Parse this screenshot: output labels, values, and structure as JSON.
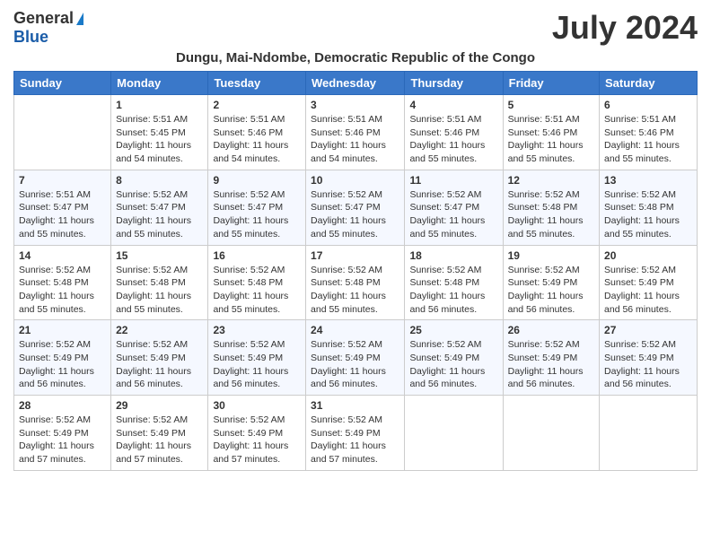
{
  "logo": {
    "general": "General",
    "blue": "Blue"
  },
  "title": "July 2024",
  "subtitle": "Dungu, Mai-Ndombe, Democratic Republic of the Congo",
  "days_of_week": [
    "Sunday",
    "Monday",
    "Tuesday",
    "Wednesday",
    "Thursday",
    "Friday",
    "Saturday"
  ],
  "weeks": [
    [
      {
        "day": "",
        "sunrise": "",
        "sunset": "",
        "daylight": ""
      },
      {
        "day": "1",
        "sunrise": "Sunrise: 5:51 AM",
        "sunset": "Sunset: 5:45 PM",
        "daylight": "Daylight: 11 hours and 54 minutes."
      },
      {
        "day": "2",
        "sunrise": "Sunrise: 5:51 AM",
        "sunset": "Sunset: 5:46 PM",
        "daylight": "Daylight: 11 hours and 54 minutes."
      },
      {
        "day": "3",
        "sunrise": "Sunrise: 5:51 AM",
        "sunset": "Sunset: 5:46 PM",
        "daylight": "Daylight: 11 hours and 54 minutes."
      },
      {
        "day": "4",
        "sunrise": "Sunrise: 5:51 AM",
        "sunset": "Sunset: 5:46 PM",
        "daylight": "Daylight: 11 hours and 55 minutes."
      },
      {
        "day": "5",
        "sunrise": "Sunrise: 5:51 AM",
        "sunset": "Sunset: 5:46 PM",
        "daylight": "Daylight: 11 hours and 55 minutes."
      },
      {
        "day": "6",
        "sunrise": "Sunrise: 5:51 AM",
        "sunset": "Sunset: 5:46 PM",
        "daylight": "Daylight: 11 hours and 55 minutes."
      }
    ],
    [
      {
        "day": "7",
        "sunrise": "Sunrise: 5:51 AM",
        "sunset": "Sunset: 5:47 PM",
        "daylight": "Daylight: 11 hours and 55 minutes."
      },
      {
        "day": "8",
        "sunrise": "Sunrise: 5:52 AM",
        "sunset": "Sunset: 5:47 PM",
        "daylight": "Daylight: 11 hours and 55 minutes."
      },
      {
        "day": "9",
        "sunrise": "Sunrise: 5:52 AM",
        "sunset": "Sunset: 5:47 PM",
        "daylight": "Daylight: 11 hours and 55 minutes."
      },
      {
        "day": "10",
        "sunrise": "Sunrise: 5:52 AM",
        "sunset": "Sunset: 5:47 PM",
        "daylight": "Daylight: 11 hours and 55 minutes."
      },
      {
        "day": "11",
        "sunrise": "Sunrise: 5:52 AM",
        "sunset": "Sunset: 5:47 PM",
        "daylight": "Daylight: 11 hours and 55 minutes."
      },
      {
        "day": "12",
        "sunrise": "Sunrise: 5:52 AM",
        "sunset": "Sunset: 5:48 PM",
        "daylight": "Daylight: 11 hours and 55 minutes."
      },
      {
        "day": "13",
        "sunrise": "Sunrise: 5:52 AM",
        "sunset": "Sunset: 5:48 PM",
        "daylight": "Daylight: 11 hours and 55 minutes."
      }
    ],
    [
      {
        "day": "14",
        "sunrise": "Sunrise: 5:52 AM",
        "sunset": "Sunset: 5:48 PM",
        "daylight": "Daylight: 11 hours and 55 minutes."
      },
      {
        "day": "15",
        "sunrise": "Sunrise: 5:52 AM",
        "sunset": "Sunset: 5:48 PM",
        "daylight": "Daylight: 11 hours and 55 minutes."
      },
      {
        "day": "16",
        "sunrise": "Sunrise: 5:52 AM",
        "sunset": "Sunset: 5:48 PM",
        "daylight": "Daylight: 11 hours and 55 minutes."
      },
      {
        "day": "17",
        "sunrise": "Sunrise: 5:52 AM",
        "sunset": "Sunset: 5:48 PM",
        "daylight": "Daylight: 11 hours and 55 minutes."
      },
      {
        "day": "18",
        "sunrise": "Sunrise: 5:52 AM",
        "sunset": "Sunset: 5:48 PM",
        "daylight": "Daylight: 11 hours and 56 minutes."
      },
      {
        "day": "19",
        "sunrise": "Sunrise: 5:52 AM",
        "sunset": "Sunset: 5:49 PM",
        "daylight": "Daylight: 11 hours and 56 minutes."
      },
      {
        "day": "20",
        "sunrise": "Sunrise: 5:52 AM",
        "sunset": "Sunset: 5:49 PM",
        "daylight": "Daylight: 11 hours and 56 minutes."
      }
    ],
    [
      {
        "day": "21",
        "sunrise": "Sunrise: 5:52 AM",
        "sunset": "Sunset: 5:49 PM",
        "daylight": "Daylight: 11 hours and 56 minutes."
      },
      {
        "day": "22",
        "sunrise": "Sunrise: 5:52 AM",
        "sunset": "Sunset: 5:49 PM",
        "daylight": "Daylight: 11 hours and 56 minutes."
      },
      {
        "day": "23",
        "sunrise": "Sunrise: 5:52 AM",
        "sunset": "Sunset: 5:49 PM",
        "daylight": "Daylight: 11 hours and 56 minutes."
      },
      {
        "day": "24",
        "sunrise": "Sunrise: 5:52 AM",
        "sunset": "Sunset: 5:49 PM",
        "daylight": "Daylight: 11 hours and 56 minutes."
      },
      {
        "day": "25",
        "sunrise": "Sunrise: 5:52 AM",
        "sunset": "Sunset: 5:49 PM",
        "daylight": "Daylight: 11 hours and 56 minutes."
      },
      {
        "day": "26",
        "sunrise": "Sunrise: 5:52 AM",
        "sunset": "Sunset: 5:49 PM",
        "daylight": "Daylight: 11 hours and 56 minutes."
      },
      {
        "day": "27",
        "sunrise": "Sunrise: 5:52 AM",
        "sunset": "Sunset: 5:49 PM",
        "daylight": "Daylight: 11 hours and 56 minutes."
      }
    ],
    [
      {
        "day": "28",
        "sunrise": "Sunrise: 5:52 AM",
        "sunset": "Sunset: 5:49 PM",
        "daylight": "Daylight: 11 hours and 57 minutes."
      },
      {
        "day": "29",
        "sunrise": "Sunrise: 5:52 AM",
        "sunset": "Sunset: 5:49 PM",
        "daylight": "Daylight: 11 hours and 57 minutes."
      },
      {
        "day": "30",
        "sunrise": "Sunrise: 5:52 AM",
        "sunset": "Sunset: 5:49 PM",
        "daylight": "Daylight: 11 hours and 57 minutes."
      },
      {
        "day": "31",
        "sunrise": "Sunrise: 5:52 AM",
        "sunset": "Sunset: 5:49 PM",
        "daylight": "Daylight: 11 hours and 57 minutes."
      },
      {
        "day": "",
        "sunrise": "",
        "sunset": "",
        "daylight": ""
      },
      {
        "day": "",
        "sunrise": "",
        "sunset": "",
        "daylight": ""
      },
      {
        "day": "",
        "sunrise": "",
        "sunset": "",
        "daylight": ""
      }
    ]
  ]
}
